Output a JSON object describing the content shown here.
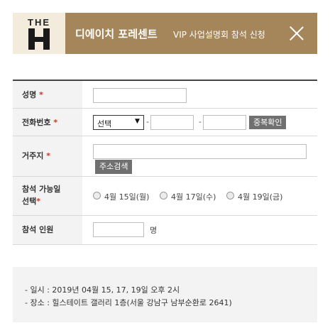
{
  "header": {
    "logo_top": "THE",
    "logo_letter": "H",
    "title": "디에이치 포레센트",
    "subtitle": "VIP 사업설명회 참석 신청",
    "close_icon": "close-icon"
  },
  "form": {
    "name": {
      "label": "성명",
      "required_mark": "*",
      "value": ""
    },
    "phone": {
      "label": "전화번호",
      "required_mark": "*",
      "prefix_selected": "선택",
      "separator": "-",
      "middle": "",
      "last": "",
      "check_button": "중복확인"
    },
    "address": {
      "label": "거주지",
      "required_mark": "*",
      "value": "",
      "search_button": "주소검색"
    },
    "date": {
      "label_line1": "참석 가능일",
      "label_line2": "선택",
      "required_mark": "*",
      "options": [
        "4월 15일(월)",
        "4월 17일(수)",
        "4월 19일(금)"
      ]
    },
    "attendees": {
      "label": "참석 인원",
      "value": "",
      "unit": "명"
    }
  },
  "info": {
    "line1": "- 일시 : 2019년 04월 15, 17, 19일 오후 2시",
    "line2": "- 장소 : 힐스테이트 갤러리 1층(서울 강남구 남부순환로 2641)"
  },
  "colors": {
    "header_bg": "#a5865a",
    "logo_bg": "#f3ebdc",
    "required": "#c0392b",
    "button_bg": "#707070"
  }
}
